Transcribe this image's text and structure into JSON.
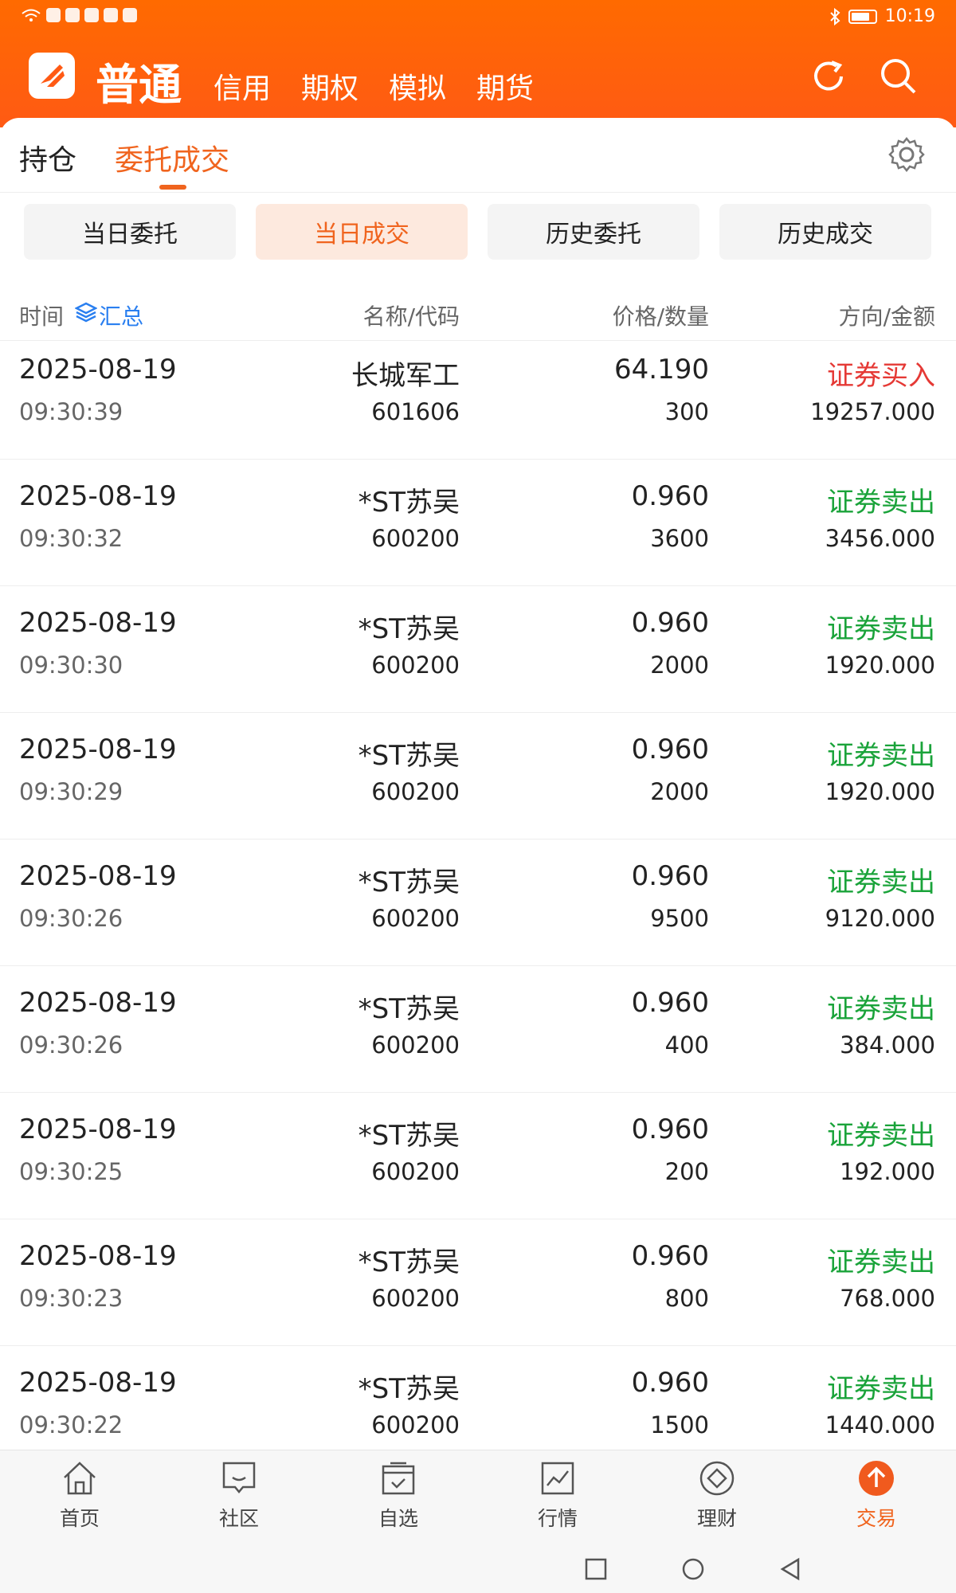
{
  "status_bar": {
    "time": "10:19"
  },
  "nav": {
    "main_tab": "普通",
    "tabs": [
      "信用",
      "期权",
      "模拟",
      "期货"
    ]
  },
  "subtabs": {
    "holdings": "持仓",
    "orders": "委托成交"
  },
  "segments": [
    "当日委托",
    "当日成交",
    "历史委托",
    "历史成交"
  ],
  "columns": {
    "time": "时间",
    "summary": "汇总",
    "name_code": "名称/代码",
    "price_qty": "价格/数量",
    "dir_amount": "方向/金额"
  },
  "rows": [
    {
      "date": "2025-08-19",
      "time": "09:30:39",
      "name": "长城军工",
      "code": "601606",
      "price": "64.190",
      "qty": "300",
      "direction": "证券买入",
      "amount": "19257.000",
      "side": "buy"
    },
    {
      "date": "2025-08-19",
      "time": "09:30:32",
      "name": "*ST苏吴",
      "code": "600200",
      "price": "0.960",
      "qty": "3600",
      "direction": "证券卖出",
      "amount": "3456.000",
      "side": "sell"
    },
    {
      "date": "2025-08-19",
      "time": "09:30:30",
      "name": "*ST苏吴",
      "code": "600200",
      "price": "0.960",
      "qty": "2000",
      "direction": "证券卖出",
      "amount": "1920.000",
      "side": "sell"
    },
    {
      "date": "2025-08-19",
      "time": "09:30:29",
      "name": "*ST苏吴",
      "code": "600200",
      "price": "0.960",
      "qty": "2000",
      "direction": "证券卖出",
      "amount": "1920.000",
      "side": "sell"
    },
    {
      "date": "2025-08-19",
      "time": "09:30:26",
      "name": "*ST苏吴",
      "code": "600200",
      "price": "0.960",
      "qty": "9500",
      "direction": "证券卖出",
      "amount": "9120.000",
      "side": "sell"
    },
    {
      "date": "2025-08-19",
      "time": "09:30:26",
      "name": "*ST苏吴",
      "code": "600200",
      "price": "0.960",
      "qty": "400",
      "direction": "证券卖出",
      "amount": "384.000",
      "side": "sell"
    },
    {
      "date": "2025-08-19",
      "time": "09:30:25",
      "name": "*ST苏吴",
      "code": "600200",
      "price": "0.960",
      "qty": "200",
      "direction": "证券卖出",
      "amount": "192.000",
      "side": "sell"
    },
    {
      "date": "2025-08-19",
      "time": "09:30:23",
      "name": "*ST苏吴",
      "code": "600200",
      "price": "0.960",
      "qty": "800",
      "direction": "证券卖出",
      "amount": "768.000",
      "side": "sell"
    },
    {
      "date": "2025-08-19",
      "time": "09:30:22",
      "name": "*ST苏吴",
      "code": "600200",
      "price": "0.960",
      "qty": "1500",
      "direction": "证券卖出",
      "amount": "1440.000",
      "side": "sell"
    }
  ],
  "tabbar": [
    {
      "label": "首页",
      "icon": "home-icon"
    },
    {
      "label": "社区",
      "icon": "community-icon"
    },
    {
      "label": "自选",
      "icon": "watchlist-icon"
    },
    {
      "label": "行情",
      "icon": "market-icon"
    },
    {
      "label": "理财",
      "icon": "wealth-icon"
    },
    {
      "label": "交易",
      "icon": "trade-icon"
    }
  ],
  "colors": {
    "brand": "#ff6a00",
    "accent": "#f0641e",
    "buy": "#e53935",
    "sell": "#1aa33a",
    "link": "#2a7ff0"
  }
}
